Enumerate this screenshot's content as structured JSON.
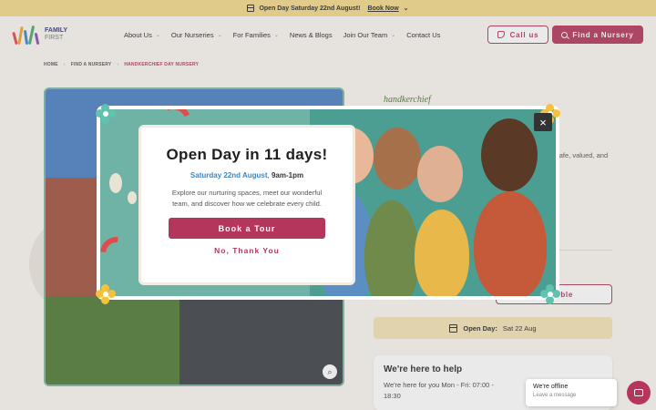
{
  "announcement": {
    "text": "Open Day Saturday 22nd August!",
    "link": "Book Now",
    "icon": "calendar-icon"
  },
  "header": {
    "logo": {
      "line1": "FAMILY",
      "line2": "FIRST"
    },
    "nav": [
      {
        "label": "About Us",
        "dropdown": true
      },
      {
        "label": "Our Nurseries",
        "dropdown": true
      },
      {
        "label": "For Families",
        "dropdown": true
      },
      {
        "label": "News & Blogs",
        "dropdown": false
      },
      {
        "label": "Join Our Team",
        "dropdown": true
      },
      {
        "label": "Contact Us",
        "dropdown": false
      }
    ],
    "call_label": "Call us",
    "find_label": "Find a Nursery"
  },
  "breadcrumb": [
    "HOME",
    "FIND A NURSERY",
    "HANDKERCHIEF DAY NURSERY"
  ],
  "page": {
    "brand_partial": "handkerchief",
    "desc_partial": "safe, valued, and",
    "availability_partial": "ble",
    "openday": {
      "label": "Open Day:",
      "value": "Sat 22 Aug"
    },
    "help": {
      "title": "We're here to help",
      "text": "We're here for you Mon - Fri: 07:00 - 18:30"
    }
  },
  "modal": {
    "title": "Open Day in 11 days!",
    "date_blue": "Saturday 22nd August",
    "time": "9am-1pm",
    "body": "Explore our nurturing spaces, meet our wonderful team, and discover how we celebrate every child.",
    "primary": "Book a Tour",
    "secondary": "No, Thank You",
    "close": "×"
  },
  "chat": {
    "status": "We're offline",
    "hint": "Leave a message"
  },
  "colors": {
    "brand": "#b5365c",
    "accent_yellow": "#f4d98a",
    "teal": "#6fb3a6",
    "date_blue": "#3a86c9"
  }
}
